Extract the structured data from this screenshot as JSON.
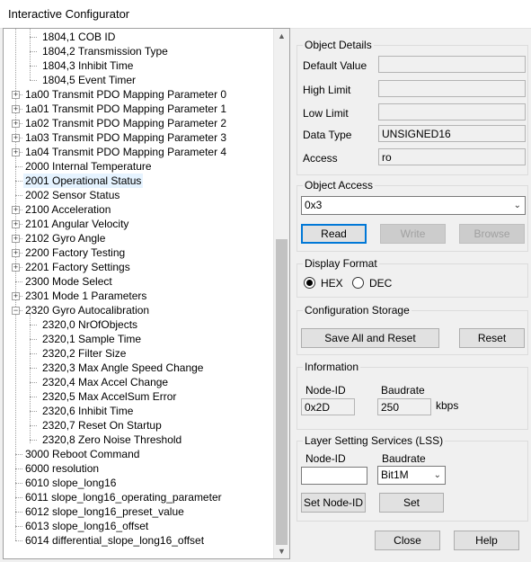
{
  "window": {
    "title": "Interactive Configurator"
  },
  "tree": {
    "items": [
      {
        "label": "1804,1 COB ID"
      },
      {
        "label": "1804,2 Transmission Type"
      },
      {
        "label": "1804,3 Inhibit Time"
      },
      {
        "label": "1804,5 Event Timer"
      },
      {
        "label": "1a00 Transmit PDO Mapping Parameter 0"
      },
      {
        "label": "1a01 Transmit PDO Mapping Parameter 1"
      },
      {
        "label": "1a02 Transmit PDO Mapping Parameter 2"
      },
      {
        "label": "1a03 Transmit PDO Mapping Parameter 3"
      },
      {
        "label": "1a04 Transmit PDO Mapping Parameter 4"
      },
      {
        "label": "2000 Internal Temperature"
      },
      {
        "label": "2001 Operational Status"
      },
      {
        "label": "2002 Sensor Status"
      },
      {
        "label": "2100 Acceleration"
      },
      {
        "label": "2101 Angular Velocity"
      },
      {
        "label": "2102 Gyro Angle"
      },
      {
        "label": "2200 Factory Testing"
      },
      {
        "label": "2201 Factory Settings"
      },
      {
        "label": "2300 Mode Select"
      },
      {
        "label": "2301 Mode 1 Parameters"
      },
      {
        "label": "2320 Gyro Autocalibration"
      },
      {
        "label": "2320,0 NrOfObjects"
      },
      {
        "label": "2320,1 Sample Time"
      },
      {
        "label": "2320,2 Filter Size"
      },
      {
        "label": "2320,3 Max Angle Speed Change"
      },
      {
        "label": "2320,4 Max Accel Change"
      },
      {
        "label": "2320,5 Max AccelSum Error"
      },
      {
        "label": "2320,6 Inhibit Time"
      },
      {
        "label": "2320,7 Reset On Startup"
      },
      {
        "label": "2320,8 Zero Noise Threshold"
      },
      {
        "label": "3000 Reboot Command"
      },
      {
        "label": "6000 resolution"
      },
      {
        "label": "6010 slope_long16"
      },
      {
        "label": "6011 slope_long16_operating_parameter"
      },
      {
        "label": "6012 slope_long16_preset_value"
      },
      {
        "label": "6013 slope_long16_offset"
      },
      {
        "label": "6014 differential_slope_long16_offset"
      }
    ]
  },
  "object_details": {
    "title": "Object Details",
    "default_value_label": "Default Value",
    "default_value": "",
    "high_limit_label": "High Limit",
    "high_limit": "",
    "low_limit_label": "Low Limit",
    "low_limit": "",
    "data_type_label": "Data Type",
    "data_type": "UNSIGNED16",
    "access_label": "Access",
    "access": "ro"
  },
  "object_access": {
    "title": "Object Access",
    "selected": "0x3",
    "read": "Read",
    "write": "Write",
    "browse": "Browse"
  },
  "display_format": {
    "title": "Display Format",
    "hex": "HEX",
    "dec": "DEC",
    "selected": "HEX"
  },
  "config_storage": {
    "title": "Configuration Storage",
    "save": "Save All and Reset",
    "reset": "Reset"
  },
  "information": {
    "title": "Information",
    "node_id_label": "Node-ID",
    "node_id": "0x2D",
    "baudrate_label": "Baudrate",
    "baudrate": "250",
    "unit": "kbps"
  },
  "lss": {
    "title": "Layer Setting Services (LSS)",
    "node_id_label": "Node-ID",
    "node_id": "",
    "baudrate_label": "Baudrate",
    "baudrate": "Bit1M",
    "set_node": "Set Node-ID",
    "set": "Set"
  },
  "footer": {
    "close": "Close",
    "help": "Help"
  }
}
